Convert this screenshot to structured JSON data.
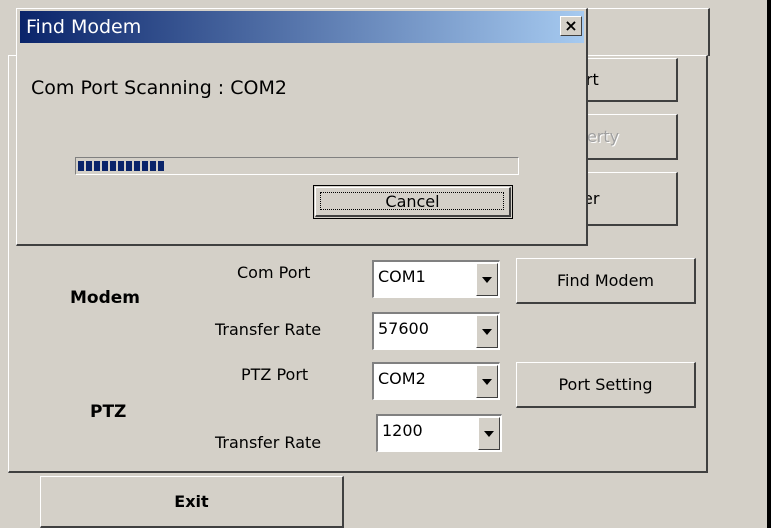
{
  "main": {
    "buttons": {
      "port": "Port",
      "property": "operty",
      "server": "rver",
      "find_modem": "Find Modem",
      "port_setting": "Port Setting",
      "exit": "Exit"
    },
    "modem": {
      "group_label": "Modem",
      "com_port_label": "Com Port",
      "com_port_value": "COM1",
      "transfer_rate_label": "Transfer Rate",
      "transfer_rate_value": "57600"
    },
    "ptz": {
      "group_label": "PTZ",
      "ptz_port_label": "PTZ Port",
      "ptz_port_value": "COM2",
      "transfer_rate_label": "Transfer Rate",
      "transfer_rate_value": "1200"
    }
  },
  "dialog": {
    "title": "Find Modem",
    "close_label": "×",
    "status": "Com Port Scanning : COM2",
    "progress": 0.2,
    "cancel_label": "Cancel"
  }
}
